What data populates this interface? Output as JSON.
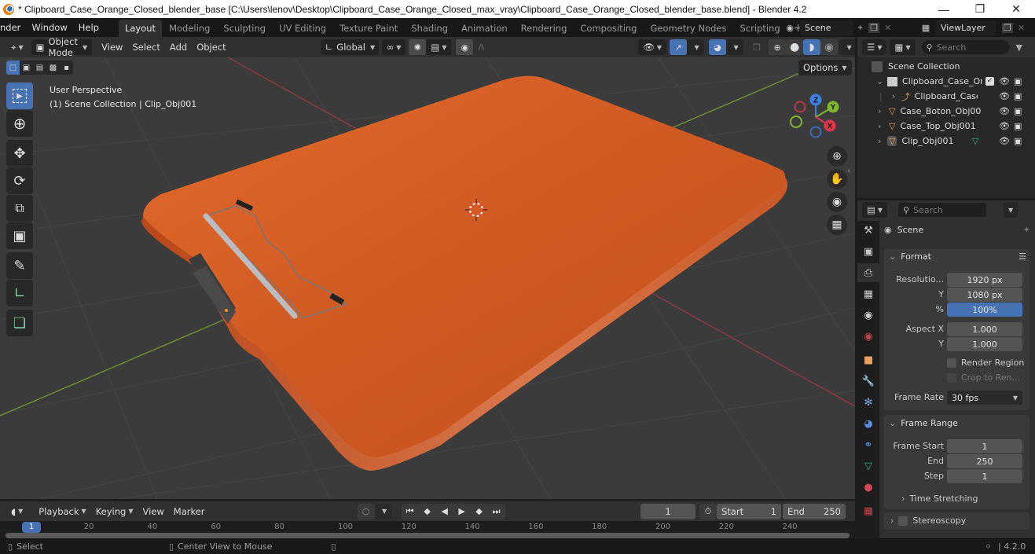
{
  "window": {
    "title": "* Clipboard_Case_Orange_Closed_blender_base [C:\\Users\\lenov\\Desktop\\Clipboard_Case_Orange_Closed_max_vray\\Clipboard_Case_Orange_Closed_blender_base.blend] - Blender 4.2",
    "minimize": "—",
    "maximize": "❐",
    "close": "✕"
  },
  "menubar": {
    "menus": [
      "nder",
      "Window",
      "Help"
    ],
    "workspaces": [
      "Layout",
      "Modeling",
      "Sculpting",
      "UV Editing",
      "Texture Paint",
      "Shading",
      "Animation",
      "Rendering",
      "Compositing",
      "Geometry Nodes",
      "Scripting"
    ],
    "active_workspace": "Layout",
    "add_workspace": "+",
    "scene_name": "Scene",
    "view_layer": "ViewLayer"
  },
  "viewport": {
    "mode": "Object Mode",
    "menus": [
      "View",
      "Select",
      "Add",
      "Object"
    ],
    "transform_orientation": "Global",
    "options_label": "Options",
    "view_name": "User Perspective",
    "collection_info": "(1) Scene Collection | Clip_Obj001",
    "gizmo_axes": {
      "x": "X",
      "y": "Y",
      "z": "Z"
    },
    "tools": [
      "select-box",
      "cursor",
      "move",
      "rotate",
      "scale",
      "transform",
      "annotate",
      "measure",
      "add-cube"
    ],
    "nav_buttons": [
      "zoom",
      "pan",
      "camera",
      "ortho-grid"
    ],
    "object_color": "#d9622a"
  },
  "timeline": {
    "menus": [
      "Playback",
      "Keying",
      "View",
      "Marker"
    ],
    "current_frame": "1",
    "start_label": "Start",
    "start_value": "1",
    "end_label": "End",
    "end_value": "250",
    "ruler_ticks": [
      "20",
      "40",
      "60",
      "80",
      "100",
      "120",
      "140",
      "160",
      "180",
      "200",
      "220",
      "240"
    ],
    "playhead": "1"
  },
  "statusbar": {
    "select": "Select",
    "center_view": "Center View to Mouse",
    "version": "4.2.0"
  },
  "outliner": {
    "search_placeholder": "Search",
    "root": "Scene Collection",
    "items": [
      {
        "name": "Clipboard_Case_Or",
        "type": "collection",
        "indent": 1
      },
      {
        "name": "Clipboard_Case",
        "type": "empty",
        "indent": 2
      },
      {
        "name": "Case_Boton_Obj00",
        "type": "mesh",
        "indent": 1
      },
      {
        "name": "Case_Top_Obj001",
        "type": "mesh",
        "indent": 1
      },
      {
        "name": "Clip_Obj001",
        "type": "mesh",
        "indent": 1
      }
    ]
  },
  "properties": {
    "search_placeholder": "Search",
    "context": "Scene",
    "format": {
      "title": "Format",
      "resolution_label": "Resolutio...",
      "res_x": "1920 px",
      "y_label": "Y",
      "res_y": "1080 px",
      "pct_label": "%",
      "res_pct": "100%",
      "aspect_label": "Aspect X",
      "aspect_x": "1.000",
      "aspect_y_label": "Y",
      "aspect_y": "1.000",
      "render_region": "Render Region",
      "crop": "Crop to Ren...",
      "frame_rate_label": "Frame Rate",
      "frame_rate": "30 fps"
    },
    "frame_range": {
      "title": "Frame Range",
      "start_label": "Frame Start",
      "start": "1",
      "end_label": "End",
      "end": "250",
      "step_label": "Step",
      "step": "1",
      "time_stretching": "Time Stretching"
    },
    "stereoscopy": "Stereoscopy"
  }
}
